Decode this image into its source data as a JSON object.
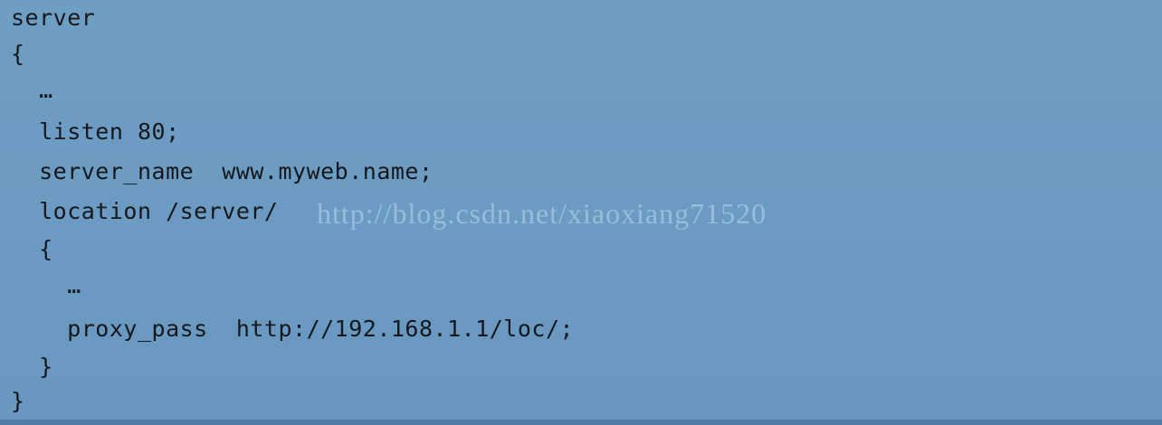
{
  "code": {
    "lines": [
      "server",
      "{",
      "  …",
      "  listen 80;",
      "  server_name  www.myweb.name;",
      "  location /server/",
      "  {",
      "    …",
      "    proxy_pass  http://192.168.1.1/loc/;",
      "  }",
      "}"
    ]
  },
  "watermark": {
    "text": "http://blog.csdn.net/xiaoxiang71520"
  },
  "colors": {
    "background": "#6b9bc2",
    "text": "#16181c",
    "watermark": "#a9c8e2"
  }
}
